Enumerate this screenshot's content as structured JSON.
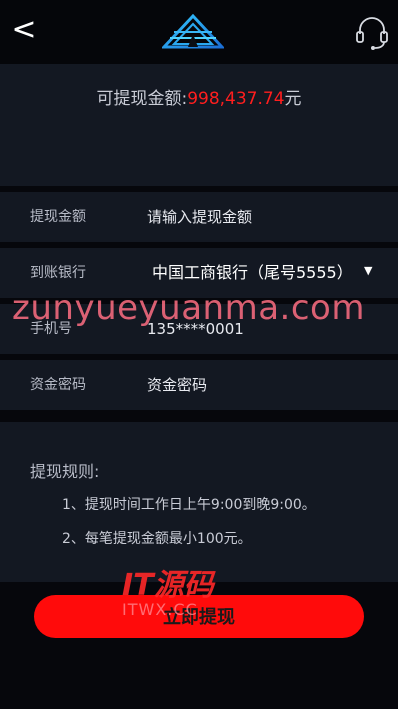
{
  "header": {
    "back_icon": "<",
    "logo_icon": "app-logo-icon",
    "service_icon": "headset-icon"
  },
  "balance": {
    "label": "可提现金额:",
    "amount": "998,437.74",
    "unit": "元"
  },
  "form": {
    "amount_label": "提现金额",
    "amount_placeholder": "请输入提现金额",
    "bank_label": "到账银行",
    "bank_value": "中国工商银行（尾号5555）",
    "bank_arrow": "▼",
    "phone_label": "手机号",
    "phone_value": "135****0001",
    "password_label": "资金密码",
    "password_placeholder": "资金密码"
  },
  "rules": {
    "title": "提现规则:",
    "items": [
      "1、提现时间工作日上午9:00到晚9:00。",
      "2、每笔提现金额最小100元。"
    ]
  },
  "submit_label": "立即提现",
  "watermark": {
    "site": "zunyueyuanma.com",
    "brand": "IT源码",
    "sub": "ITWX.CC"
  },
  "colors": {
    "background": "#06070c",
    "panel": "#131822",
    "accent": "#ff0b0b",
    "amount": "#ff1e1e"
  }
}
